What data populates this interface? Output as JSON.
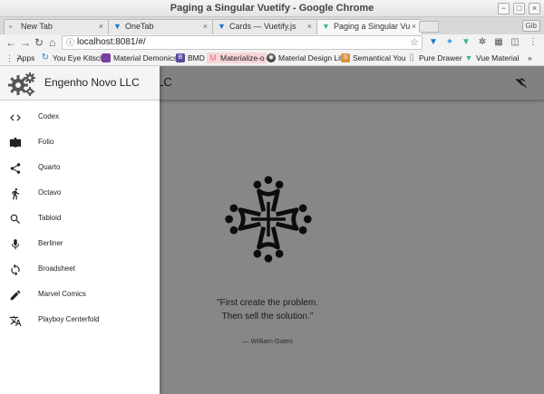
{
  "window": {
    "title": "Paging a Singular Vuetify - Google Chrome",
    "controls": [
      "−",
      "□",
      "×"
    ]
  },
  "tabs": [
    {
      "label": "New Tab",
      "icon": "blank-page-icon",
      "active": false
    },
    {
      "label": "OneTab",
      "icon": "onetab-icon",
      "active": false
    },
    {
      "label": "Cards — Vuetify.js",
      "icon": "vuetify-icon",
      "active": false
    },
    {
      "label": "Paging a Singular Vu",
      "icon": "vue-icon",
      "active": true
    }
  ],
  "profile_badge": "Gib",
  "address": {
    "url": "localhost:8081/#/"
  },
  "bookmarks": [
    {
      "label": "Apps",
      "icon": "apps-grid-icon",
      "color": "#4a4a4a"
    },
    {
      "label": "You Eye Kitsch",
      "icon": "refresh-icon",
      "color": "#3b82c4"
    },
    {
      "label": "Material Demonics",
      "icon": "material-icon",
      "color": "#7a3fa0"
    },
    {
      "label": "BMD",
      "icon": "b-icon",
      "color": "#5a4a9a"
    },
    {
      "label": "Materialize-o",
      "icon": "materialize-icon",
      "color": "#e8737a"
    },
    {
      "label": "Material Design Lite",
      "icon": "mdl-icon",
      "color": "#444444"
    },
    {
      "label": "Semantical You",
      "icon": "su-icon",
      "color": "#e0903a"
    },
    {
      "label": "Pure Drawer",
      "icon": "page-icon",
      "color": "#888888"
    },
    {
      "label": "Vue Material",
      "icon": "vue-icon",
      "color": "#42b883"
    }
  ],
  "bookmarks_overflow": "»",
  "app": {
    "title": "Novo LLC",
    "quote_line1": "\"First create the problem.",
    "quote_line2": "Then sell the solution.\"",
    "quote_author": "— William Gates"
  },
  "drawer": {
    "company": "Engenho Novo LLC",
    "items": [
      {
        "label": "Codex",
        "icon": "code-icon"
      },
      {
        "label": "Folio",
        "icon": "book-icon"
      },
      {
        "label": "Quarto",
        "icon": "share-icon"
      },
      {
        "label": "Octavo",
        "icon": "walk-icon"
      },
      {
        "label": "Tabloid",
        "icon": "search-icon"
      },
      {
        "label": "Berliner",
        "icon": "mic-icon"
      },
      {
        "label": "Broadsheet",
        "icon": "sync-icon"
      },
      {
        "label": "Marvel Comics",
        "icon": "pencil-icon"
      },
      {
        "label": "Playboy Centerfold",
        "icon": "translate-icon"
      }
    ]
  },
  "colors": {
    "scrim": "#000000",
    "vue_green": "#42b883",
    "vuetify_blue": "#1976d2"
  }
}
